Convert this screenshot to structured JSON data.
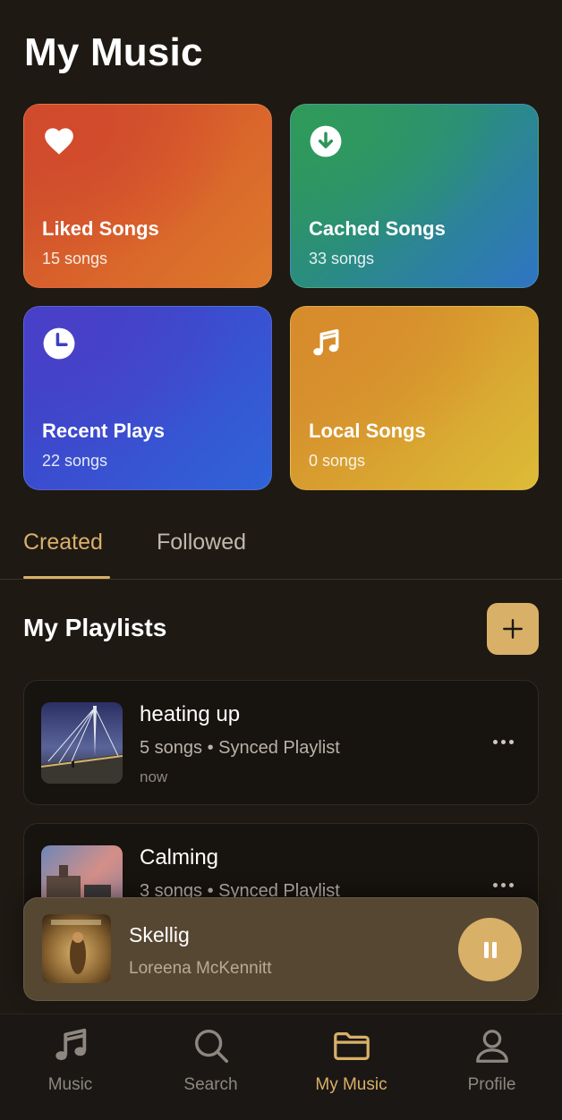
{
  "header": {
    "title": "My Music"
  },
  "cards": [
    {
      "title": "Liked Songs",
      "count": "15 songs",
      "icon": "heart-icon"
    },
    {
      "title": "Cached Songs",
      "count": "33 songs",
      "icon": "download-icon"
    },
    {
      "title": "Recent Plays",
      "count": "22 songs",
      "icon": "clock-icon"
    },
    {
      "title": "Local Songs",
      "count": "0 songs",
      "icon": "music-note-icon"
    }
  ],
  "tabs": [
    {
      "label": "Created",
      "active": true
    },
    {
      "label": "Followed",
      "active": false
    }
  ],
  "playlists_section": {
    "title": "My Playlists",
    "add_icon": "plus-icon"
  },
  "playlists": [
    {
      "name": "heating up",
      "meta": "5 songs • Synced Playlist",
      "time": "now"
    },
    {
      "name": "Calming",
      "meta": "3 songs • Synced Playlist",
      "time": ""
    }
  ],
  "now_playing": {
    "title": "Skellig",
    "artist": "Loreena McKennitt",
    "state_icon": "pause-icon"
  },
  "nav": [
    {
      "label": "Music",
      "icon": "music-note-icon",
      "active": false
    },
    {
      "label": "Search",
      "icon": "search-icon",
      "active": false
    },
    {
      "label": "My Music",
      "icon": "folder-icon",
      "active": true
    },
    {
      "label": "Profile",
      "icon": "person-icon",
      "active": false
    }
  ],
  "colors": {
    "background": "#1e1913",
    "accent": "#d9b068",
    "liked": "#d9622b",
    "cached": "#2a8d7f",
    "recent": "#3a4fd0",
    "local": "#d89f2f",
    "mini_player": "#564733"
  }
}
